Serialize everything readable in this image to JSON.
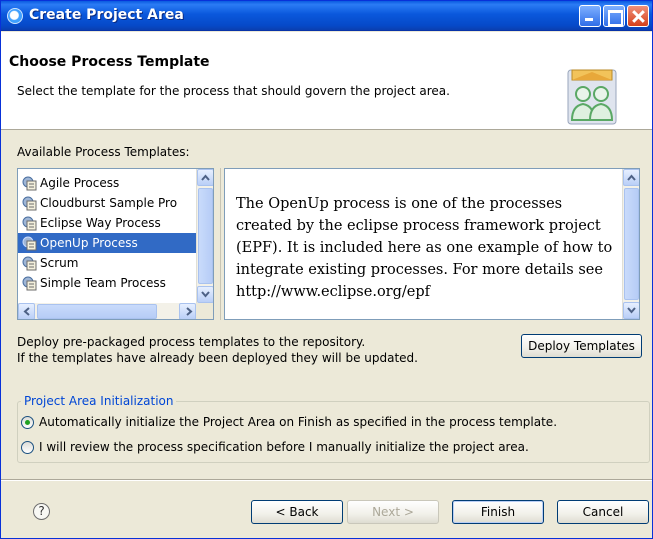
{
  "window": {
    "title": "Create Project Area",
    "icon": "eclipse-app-icon",
    "controls": [
      "minimize-icon",
      "maximize-icon",
      "close-icon"
    ]
  },
  "header": {
    "title": "Choose Process Template",
    "description": "Select the template for the process that should govern the project area.",
    "icon": "project-area-people-icon"
  },
  "templates": {
    "label": "Available Process Templates:",
    "items": [
      {
        "label": "Agile Process",
        "selected": false
      },
      {
        "label": "Cloudburst Sample Pro",
        "selected": false
      },
      {
        "label": "Eclipse Way Process",
        "selected": false
      },
      {
        "label": "OpenUp Process",
        "selected": true
      },
      {
        "label": "Scrum",
        "selected": false
      },
      {
        "label": "Simple Team Process",
        "selected": false
      }
    ],
    "item_icon": "process-template-icon"
  },
  "description": {
    "text": "The OpenUp process is one of the processes created by the eclipse process framework project (EPF). It is included here as one example of how to integrate existing processes. For more details see http://www.eclipse.org/epf"
  },
  "deploy": {
    "line1": "Deploy pre-packaged process templates to the repository.",
    "line2": "If the templates have already been deployed they will be updated.",
    "button_label": "Deploy Templates"
  },
  "initialization": {
    "title": "Project Area Initialization",
    "options": [
      {
        "label": "Automatically initialize the Project Area on Finish as specified in the process template.",
        "selected": true
      },
      {
        "label": "I will review the process specification before I manually initialize the project area.",
        "selected": false
      }
    ]
  },
  "footer": {
    "help_label": "?",
    "back_label": "< Back",
    "next_label": "Next >",
    "finish_label": "Finish",
    "cancel_label": "Cancel"
  },
  "colors": {
    "titlebar": "#0a58dc",
    "selection": "#316ac5",
    "group_title": "#0046d5",
    "dialog_bg": "#ece9d8"
  }
}
